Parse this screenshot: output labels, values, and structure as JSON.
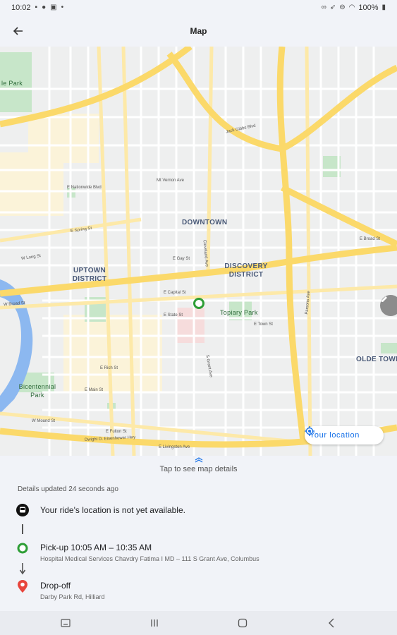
{
  "status_bar": {
    "time": "10:02",
    "battery": "100%"
  },
  "header": {
    "title": "Map"
  },
  "map": {
    "labels": {
      "downtown": "DOWNTOWN",
      "discovery_district": "DISCOVERY DISTRICT",
      "uptown_district": "UPTOWN DISTRICT",
      "olde_towne_east": "OLDE TOWNE EAS",
      "topiary_park": "Topiary Park",
      "bicentennial_park": "Bicentennial Park",
      "goodale_park": "le Park"
    },
    "streets": {
      "jack_gibbs": "Jack Gibbs Blvd",
      "mt_vernon": "Mt Vernon Ave",
      "nationwide": "E Nationwide Blvd",
      "spring": "E Spring St",
      "long": "W Long St",
      "gay": "E Gay St",
      "broad": "W Broad St",
      "capital": "E Capital St",
      "state": "E State St",
      "town": "E Town St",
      "rich": "E Rich St",
      "main": "E Main St",
      "mound": "W Mound St",
      "fulton": "E Fulton St",
      "livingston": "E Livingston Ave",
      "dwight": "Dwight D. Eisenhower Hwy",
      "grant": "S Grant Ave",
      "cleveland": "Cleveland Ave",
      "parsons": "Parsons Ave",
      "broad_east": "E Broad St"
    },
    "your_location_label": "Your location"
  },
  "details": {
    "toggle_label": "Tap to see map details",
    "updated_text": "Details updated 24 seconds ago"
  },
  "timeline": {
    "ride": {
      "title": "Your ride's location is not yet available."
    },
    "pickup": {
      "title": "Pick-up 10:05 AM – 10:35 AM",
      "address": "Hospital Medical Services Chavdry Fatima I MD – 111 S Grant Ave, Columbus"
    },
    "dropoff": {
      "title": "Drop-off",
      "address": "Darby Park Rd, Hilliard"
    }
  },
  "colors": {
    "accent": "#1a73e8",
    "pickup": "#2e9e36",
    "dropoff": "#e8453c",
    "highway": "#fbd96a",
    "park": "#c7e6c9",
    "water": "#8cb8f0"
  }
}
